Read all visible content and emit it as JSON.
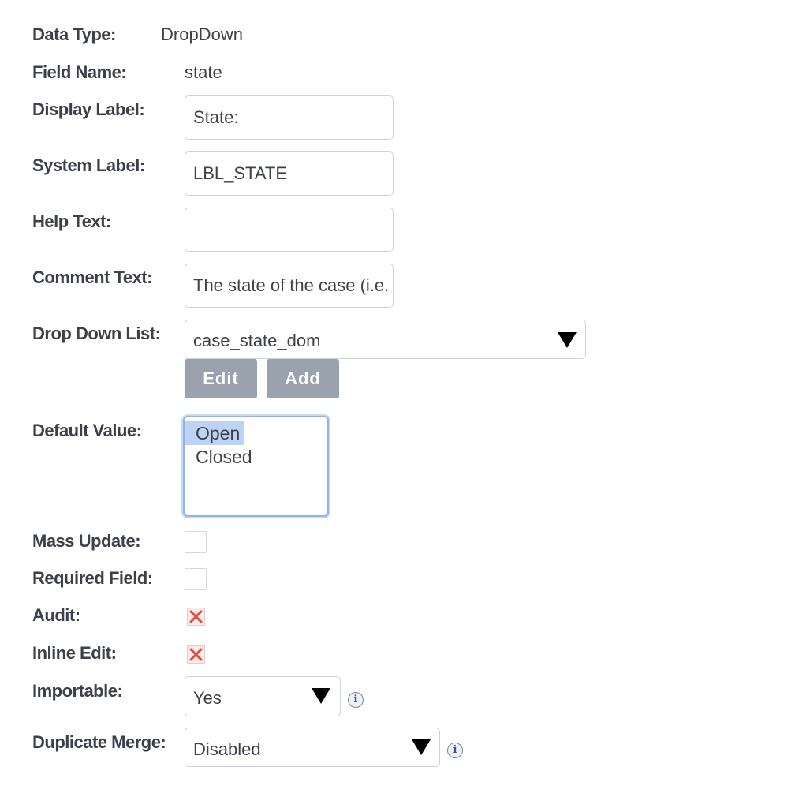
{
  "fields": {
    "data_type": {
      "label": "Data Type:",
      "value": "DropDown"
    },
    "field_name": {
      "label": "Field Name:",
      "value": "state"
    },
    "display_label": {
      "label": "Display Label:",
      "value": "State:"
    },
    "system_label": {
      "label": "System Label:",
      "value": "LBL_STATE"
    },
    "help_text": {
      "label": "Help Text:",
      "value": ""
    },
    "comment_text": {
      "label": "Comment Text:",
      "value": "The state of the case (i.e."
    },
    "drop_down_list": {
      "label": "Drop Down List:",
      "selected": "case_state_dom",
      "edit_label": "Edit",
      "add_label": "Add"
    },
    "default_value": {
      "label": "Default Value:",
      "options": [
        "Open",
        "Closed"
      ],
      "selected": "Open"
    },
    "mass_update": {
      "label": "Mass Update:",
      "checked": false
    },
    "required_field": {
      "label": "Required Field:",
      "checked": false
    },
    "audit": {
      "label": "Audit:",
      "checked": true
    },
    "inline_edit": {
      "label": "Inline Edit:",
      "checked": true
    },
    "importable": {
      "label": "Importable:",
      "selected": "Yes",
      "info_icon": "i"
    },
    "duplicate_merge": {
      "label": "Duplicate Merge:",
      "selected": "Disabled",
      "info_icon": "i"
    }
  },
  "colors": {
    "label_text": "#3d3f4a",
    "button_bg": "#9aa3ad",
    "focus_ring": "#8fb3ea",
    "selected_option": "#bcd3f5",
    "check_mark": "#e24d42"
  }
}
